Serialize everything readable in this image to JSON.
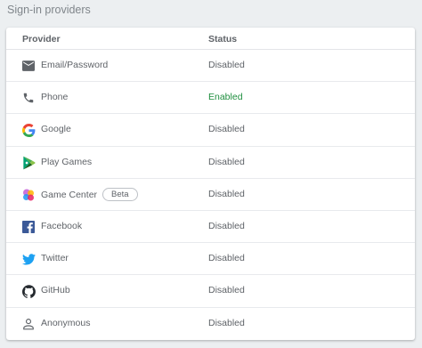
{
  "section_title": "Sign-in providers",
  "table": {
    "headers": {
      "provider": "Provider",
      "status": "Status"
    },
    "rows": [
      {
        "name": "Email/Password",
        "icon": "email-icon",
        "status": "Disabled"
      },
      {
        "name": "Phone",
        "icon": "phone-icon",
        "status": "Enabled"
      },
      {
        "name": "Google",
        "icon": "google-icon",
        "status": "Disabled"
      },
      {
        "name": "Play Games",
        "icon": "play-games-icon",
        "status": "Disabled"
      },
      {
        "name": "Game Center",
        "icon": "game-center-icon",
        "status": "Disabled",
        "badge": "Beta"
      },
      {
        "name": "Facebook",
        "icon": "facebook-icon",
        "status": "Disabled"
      },
      {
        "name": "Twitter",
        "icon": "twitter-icon",
        "status": "Disabled"
      },
      {
        "name": "GitHub",
        "icon": "github-icon",
        "status": "Disabled"
      },
      {
        "name": "Anonymous",
        "icon": "person-icon",
        "status": "Disabled"
      }
    ]
  },
  "colors": {
    "enabled": "#1e8e3e",
    "disabled": "#5f6368",
    "facebook": "#3b5998",
    "twitter": "#1da1f2"
  }
}
